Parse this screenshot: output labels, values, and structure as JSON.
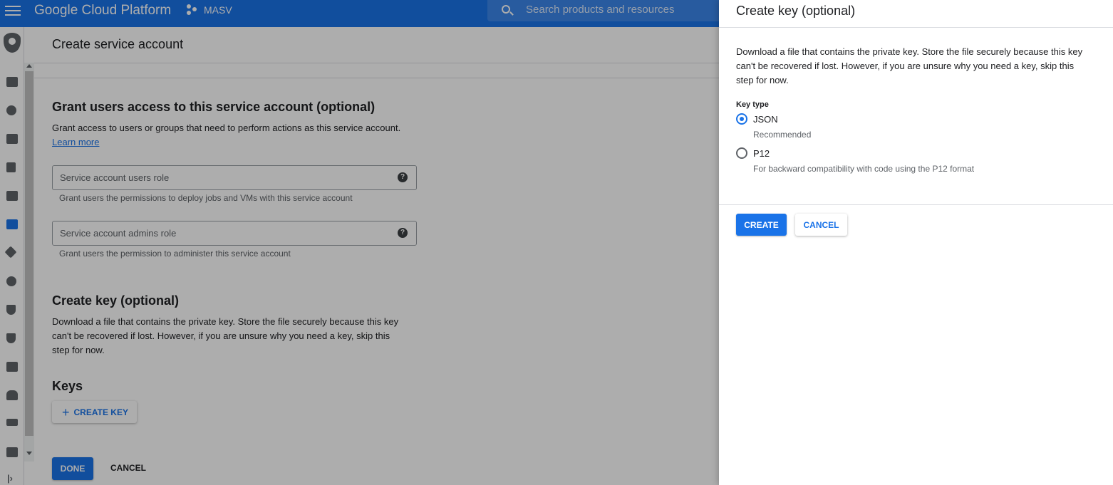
{
  "topbar": {
    "brand": "Google Cloud Platform",
    "project": "MASV",
    "search_placeholder": "Search products and resources",
    "bg_color": "#1a73e8"
  },
  "page": {
    "title": "Create service account"
  },
  "grant_section": {
    "title": "Grant users access to this service account (optional)",
    "description": "Grant access to users or groups that need to perform actions as this service account.",
    "learn_more": "Learn more",
    "users_role_field": "Service account users role",
    "users_role_hint": "Grant users the permissions to deploy jobs and VMs with this service account",
    "admins_role_field": "Service account admins role",
    "admins_role_hint": "Grant users the permission to administer this service account"
  },
  "key_section": {
    "title": "Create key (optional)",
    "description": "Download a file that contains the private key. Store the file securely because this key can't be recovered if lost. However, if you are unsure why you need a key, skip this step for now."
  },
  "keys_section": {
    "title": "Keys",
    "create_key_button": "CREATE KEY"
  },
  "footer": {
    "done_button": "DONE",
    "cancel_button": "CANCEL"
  },
  "panel": {
    "title": "Create key (optional)",
    "description": "Download a file that contains the private key. Store the file securely because this key can't be recovered if lost. However, if you are unsure why you need a key, skip this step for now.",
    "key_type_label": "Key type",
    "options": [
      {
        "label": "JSON",
        "sub": "Recommended",
        "selected": true
      },
      {
        "label": "P12",
        "sub": "For backward compatibility with code using the P12 format",
        "selected": false
      }
    ],
    "create_button": "CREATE",
    "cancel_button": "CANCEL"
  },
  "sidebar_icons": [
    "add-person-icon",
    "account-circle-icon",
    "wrench-icon",
    "document-icon",
    "calendar-icon",
    "service-accounts-icon",
    "tag-icon",
    "gear-icon",
    "shield-icon",
    "privacy-shield-icon",
    "list-box-icon",
    "hat-icon",
    "lines-icon",
    "dashboard-icon"
  ]
}
